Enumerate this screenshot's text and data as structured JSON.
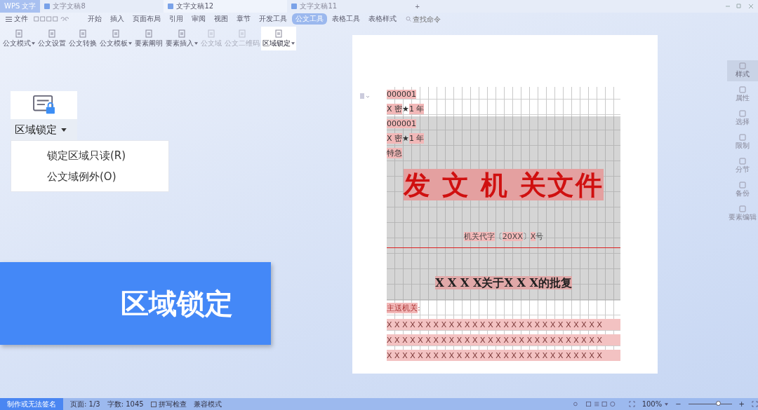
{
  "tabs": [
    {
      "label": "WPS 文字",
      "kind": "home",
      "selected": false
    },
    {
      "label": "文字文稿8",
      "kind": "doc",
      "selected": false
    },
    {
      "label": "文字文稿12",
      "kind": "doc",
      "selected": true
    },
    {
      "label": "文字文稿11",
      "kind": "doc",
      "selected": false
    }
  ],
  "new_tab": "+",
  "menu": {
    "file": "文件",
    "items": [
      {
        "label": "开始",
        "selected": false
      },
      {
        "label": "插入",
        "selected": false
      },
      {
        "label": "页面布局",
        "selected": false
      },
      {
        "label": "引用",
        "selected": false
      },
      {
        "label": "审阅",
        "selected": false
      },
      {
        "label": "视图",
        "selected": false
      },
      {
        "label": "章节",
        "selected": false
      },
      {
        "label": "开发工具",
        "selected": false
      },
      {
        "label": "公文工具",
        "selected": true
      },
      {
        "label": "表格工具",
        "selected": false
      },
      {
        "label": "表格样式",
        "selected": false
      }
    ],
    "search": {
      "placeholder": "查找命令"
    }
  },
  "ribbon": [
    {
      "label": "公文模式",
      "dropdown": true,
      "disabled": false,
      "selected": false
    },
    {
      "label": "公文设置",
      "dropdown": false,
      "disabled": false,
      "selected": false
    },
    {
      "label": "公文转换",
      "dropdown": false,
      "disabled": false,
      "selected": false
    },
    {
      "label": "公文模板",
      "dropdown": true,
      "disabled": false,
      "selected": false
    },
    {
      "label": "要素阐明",
      "dropdown": false,
      "disabled": false,
      "selected": false
    },
    {
      "label": "要素插入",
      "dropdown": true,
      "disabled": false,
      "selected": false
    },
    {
      "label": "公文域",
      "dropdown": false,
      "disabled": true,
      "selected": false
    },
    {
      "label": "公文二维码",
      "dropdown": false,
      "disabled": true,
      "selected": false
    },
    {
      "label": "区域锁定",
      "dropdown": true,
      "disabled": false,
      "selected": true
    }
  ],
  "callout": {
    "button": "区域锁定",
    "items": [
      "锁定区域只读(R)",
      "公文域例外(O)"
    ]
  },
  "banner": "区域锁定",
  "document": {
    "header_lines": [
      [
        {
          "text": "000001",
          "highlighted": true
        }
      ],
      [
        {
          "text": "X 密",
          "highlighted": true
        },
        {
          "text": "★",
          "highlighted": false
        },
        {
          "text": "1 年",
          "highlighted": true
        }
      ]
    ],
    "locked": {
      "header_lines": [
        [
          {
            "text": "000001",
            "highlighted": true
          }
        ],
        [
          {
            "text": "X 密",
            "highlighted": true
          },
          {
            "text": "★",
            "highlighted": false
          },
          {
            "text": "1 年",
            "highlighted": true
          }
        ],
        [
          {
            "text": "特急",
            "highlighted": true
          }
        ]
      ],
      "title": "发 文 机 关文件",
      "doc_number": [
        {
          "text": "机关代字",
          "highlighted": true
        },
        {
          "text": "〔",
          "highlighted": false
        },
        {
          "text": "20XX",
          "highlighted": true
        },
        {
          "text": "〕",
          "highlighted": false
        },
        {
          "text": "X",
          "highlighted": true
        },
        {
          "text": "号",
          "highlighted": false
        }
      ],
      "subject": "X X X X关于X X X的批复"
    },
    "recipient": "主送机关",
    "recipient_colon": ":",
    "body_rows": [
      "X X X X X X X X X X X X X X X X X X X X X X X X X X X X",
      "X X X X X X X X X X X X X X X X X X X X X X X X X X X X",
      "X X X X X X X X X X X X X X X X X X X X X X X X X X X X"
    ]
  },
  "sidebar": [
    {
      "label": "样式",
      "selected": true
    },
    {
      "label": "属性",
      "selected": false
    },
    {
      "label": "选择",
      "selected": false
    },
    {
      "label": "限制",
      "selected": false
    },
    {
      "label": "分节",
      "selected": false
    },
    {
      "label": "备份",
      "selected": false
    },
    {
      "label": "要素编辑",
      "selected": false
    }
  ],
  "status_bar": {
    "button": "制作或无法签名",
    "items": [
      "页面: 1/3",
      "字数: 1045"
    ],
    "spell_check": "拼写检查",
    "mode": "兼容模式",
    "zoom": "100%",
    "zoom_out": "−",
    "zoom_in": "+",
    "zoom_slider": {
      "level": 0.7
    }
  }
}
